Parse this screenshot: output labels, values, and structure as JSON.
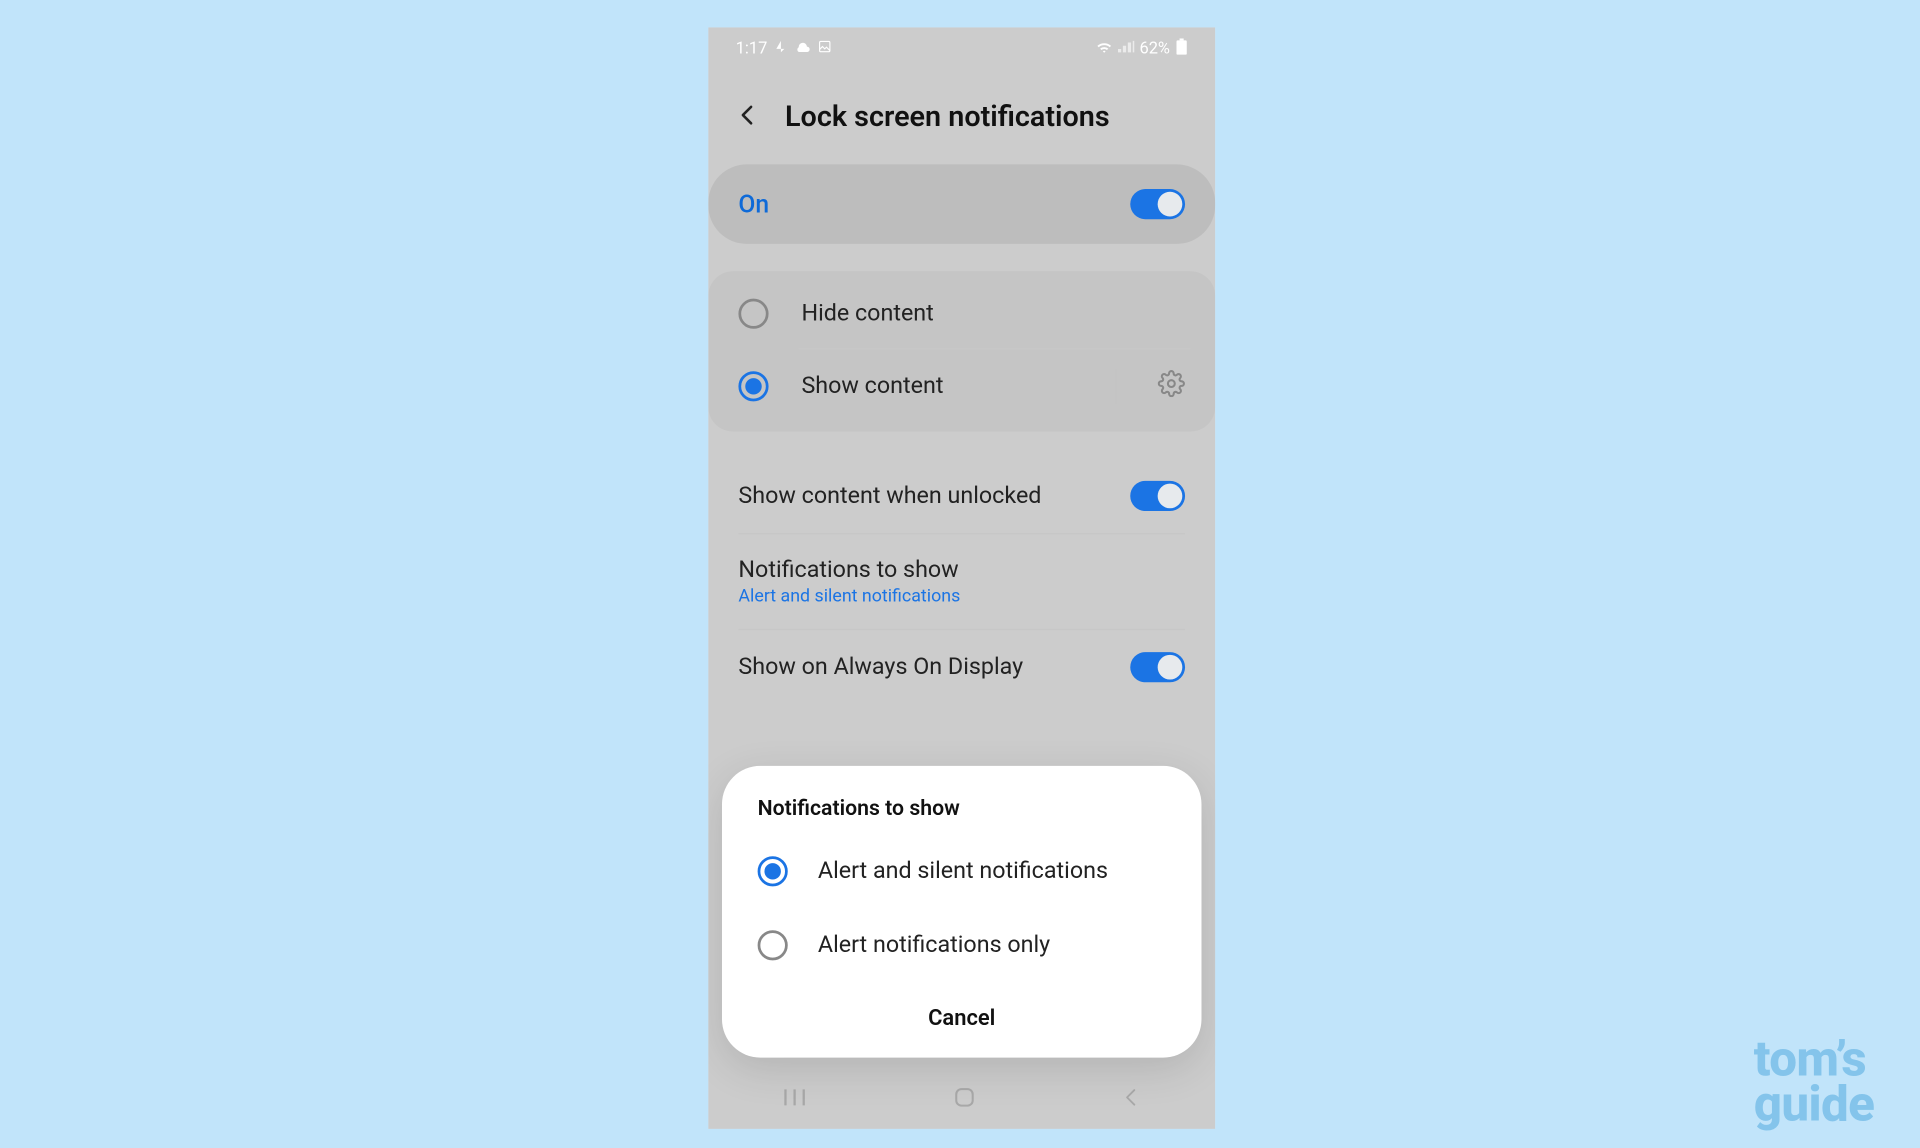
{
  "statusbar": {
    "time": "1:17",
    "battery_pct": "62%"
  },
  "header": {
    "title": "Lock screen notifications"
  },
  "masterToggle": {
    "label": "On",
    "enabled": true
  },
  "contentRadios": {
    "hide_label": "Hide content",
    "show_label": "Show content",
    "selected": "show"
  },
  "rows": {
    "show_when_unlocked": {
      "title": "Show content when unlocked",
      "enabled": true
    },
    "notifications_to_show": {
      "title": "Notifications to show",
      "subtitle": "Alert and silent notifications"
    },
    "always_on": {
      "title": "Show on Always On Display",
      "enabled": true
    }
  },
  "modal": {
    "title": "Notifications to show",
    "options": [
      {
        "label": "Alert and silent notifications",
        "selected": true
      },
      {
        "label": "Alert notifications only",
        "selected": false
      }
    ],
    "cancel": "Cancel"
  },
  "watermark": {
    "line1": "tom’s",
    "line2": "guide"
  }
}
